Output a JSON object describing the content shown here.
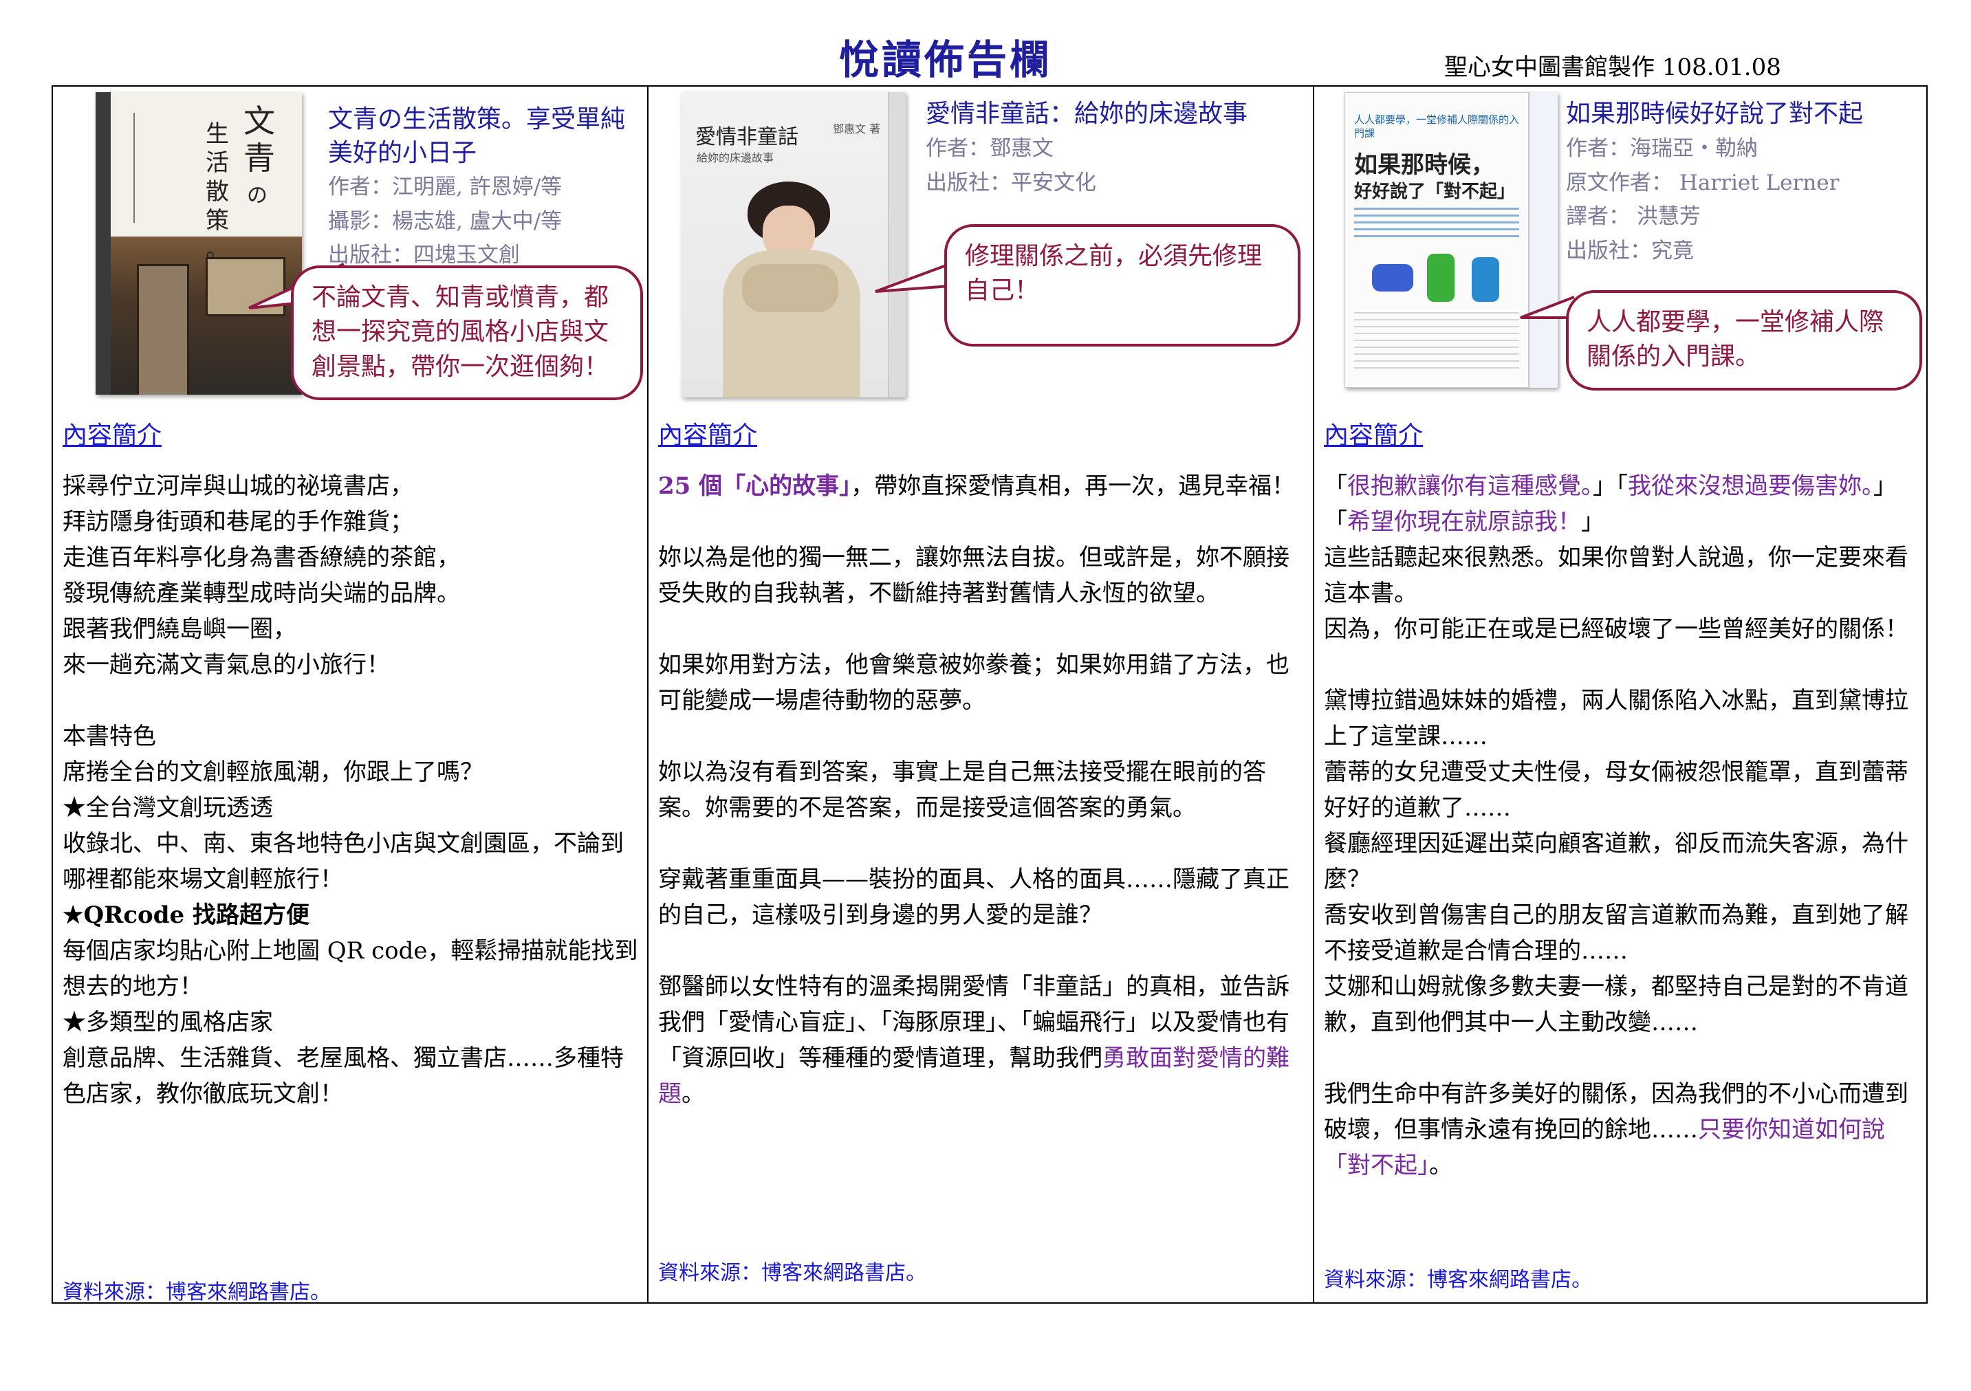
{
  "header": {
    "title": "悅讀佈告欄",
    "credit": "聖心女中圖書館製作 108.01.08"
  },
  "books": [
    {
      "title": "文青の生活散策。享受單純美好的小日子",
      "meta": [
        "作者：江明麗, 許恩婷/等",
        "攝影：楊志雄, 盧大中/等",
        "出版社：四塊玉文創"
      ],
      "cover_text": [
        "文",
        "青",
        "の",
        "生",
        "活",
        "散",
        "策",
        "。"
      ],
      "callout": "不論文青、知青或憤青，都想一探究竟的風格小店與文創景點，帶你一次逛個夠！",
      "intro_link": "內容簡介",
      "paragraphs": [
        "採尋佇立河岸與山城的祕境書店，",
        "拜訪隱身街頭和巷尾的手作雜貨；",
        "走進百年料亭化身為書香繚繞的茶館，",
        "發現傳統產業轉型成時尚尖端的品牌。",
        "跟著我們繞島嶼一圈，",
        "來一趟充滿文青氣息的小旅行！",
        "",
        "本書特色",
        "席捲全台的文創輕旅風潮，你跟上了嗎？",
        "★全台灣文創玩透透",
        "收錄北、中、南、東各地特色小店與文創園區，不論到哪裡都能來場文創輕旅行！",
        "★QRcode 找路超方便",
        "每個店家均貼心附上地圖 QR code，輕鬆掃描就能找到想去的地方！",
        "★多類型的風格店家",
        "創意品牌、生活雜貨、老屋風格、獨立書店……多種特色店家，教你徹底玩文創！"
      ],
      "source": "資料來源：博客來網路書店。"
    },
    {
      "title": "愛情非童話：給妳的床邊故事",
      "meta": [
        "作者：鄧惠文",
        "出版社：平安文化"
      ],
      "cover_text": [
        "愛情非童話",
        "給妳的床邊故事",
        "鄧惠文 著"
      ],
      "callout": "修理關係之前，必須先修理自己！",
      "intro_link": "內容簡介",
      "p1_purple_a": "25 個「心的故事」",
      "p1_rest": "，帶妳直探愛情真相，再一次，遇見幸福！",
      "p2": "妳以為是他的獨一無二，讓妳無法自拔。但或許是，妳不願接受失敗的自我執著，不斷維持著對舊情人永恆的欲望。",
      "p3": "如果妳用對方法，他會樂意被妳豢養；如果妳用錯了方法，也可能變成一場虐待動物的惡夢。",
      "p4": "妳以為沒有看到答案，事實上是自己無法接受擺在眼前的答案。妳需要的不是答案，而是接受這個答案的勇氣。",
      "p5": "穿戴著重重面具——裝扮的面具、人格的面具……隱藏了真正的自己，這樣吸引到身邊的男人愛的是誰？",
      "p6_main": "鄧醫師以女性特有的溫柔揭開愛情「非童話」的真相，並告訴我們「愛情心盲症」、「海豚原理」、「蝙蝠飛行」以及愛情也有「資源回收」等種種的愛情道理，幫助我們",
      "p6_purple": "勇敢面對愛情的難題",
      "p6_end": "。",
      "source": "資料來源：博客來網路書店。"
    },
    {
      "title": "如果那時候好好說了對不起",
      "meta": [
        "作者：海瑞亞・勒納",
        "原文作者： Harriet Lerner",
        "譯者： 洪慧芳",
        "出版社：究竟"
      ],
      "cover_text": [
        "人人都要學，一堂修補人際關係的入門課",
        "如果那時候，",
        "好好說了「對不起」"
      ],
      "callout": "人人都要學，一堂修補人際關係的入門課。",
      "intro_link": "內容簡介",
      "quote_open": "「",
      "quote_1": "很抱歉讓你有這種感覺。",
      "quote_mid1": "」「",
      "quote_2": "我從來沒想過要傷害妳。",
      "quote_mid2": "」「",
      "quote_3": "希望你現在就原諒我！",
      "quote_close": "」",
      "p2": "這些話聽起來很熟悉。如果你曾對人說過，你一定要來看這本書。",
      "p3": "因為，你可能正在或是已經破壞了一些曾經美好的關係！",
      "p4": "黛博拉錯過妹妹的婚禮，兩人關係陷入冰點，直到黛博拉上了這堂課……",
      "p5": "蕾蒂的女兒遭受丈夫性侵，母女倆被怨恨籠罩，直到蕾蒂好好的道歉了……",
      "p6": "餐廳經理因延遲出菜向顧客道歉，卻反而流失客源，為什麼？",
      "p7": "喬安收到曾傷害自己的朋友留言道歉而為難，直到她了解不接受道歉是合情合理的……",
      "p8": "艾娜和山姆就像多數夫妻一樣，都堅持自己是對的不肯道歉，直到他們其中一人主動改變……",
      "p9_main": "我們生命中有許多美好的關係，因為我們的不小心而遭到破壞，但事情永遠有挽回的餘地……",
      "p9_purple": "只要你知道如何說「對不起」",
      "p9_end": "。",
      "source": "資料來源：博客來網路書店。"
    }
  ]
}
